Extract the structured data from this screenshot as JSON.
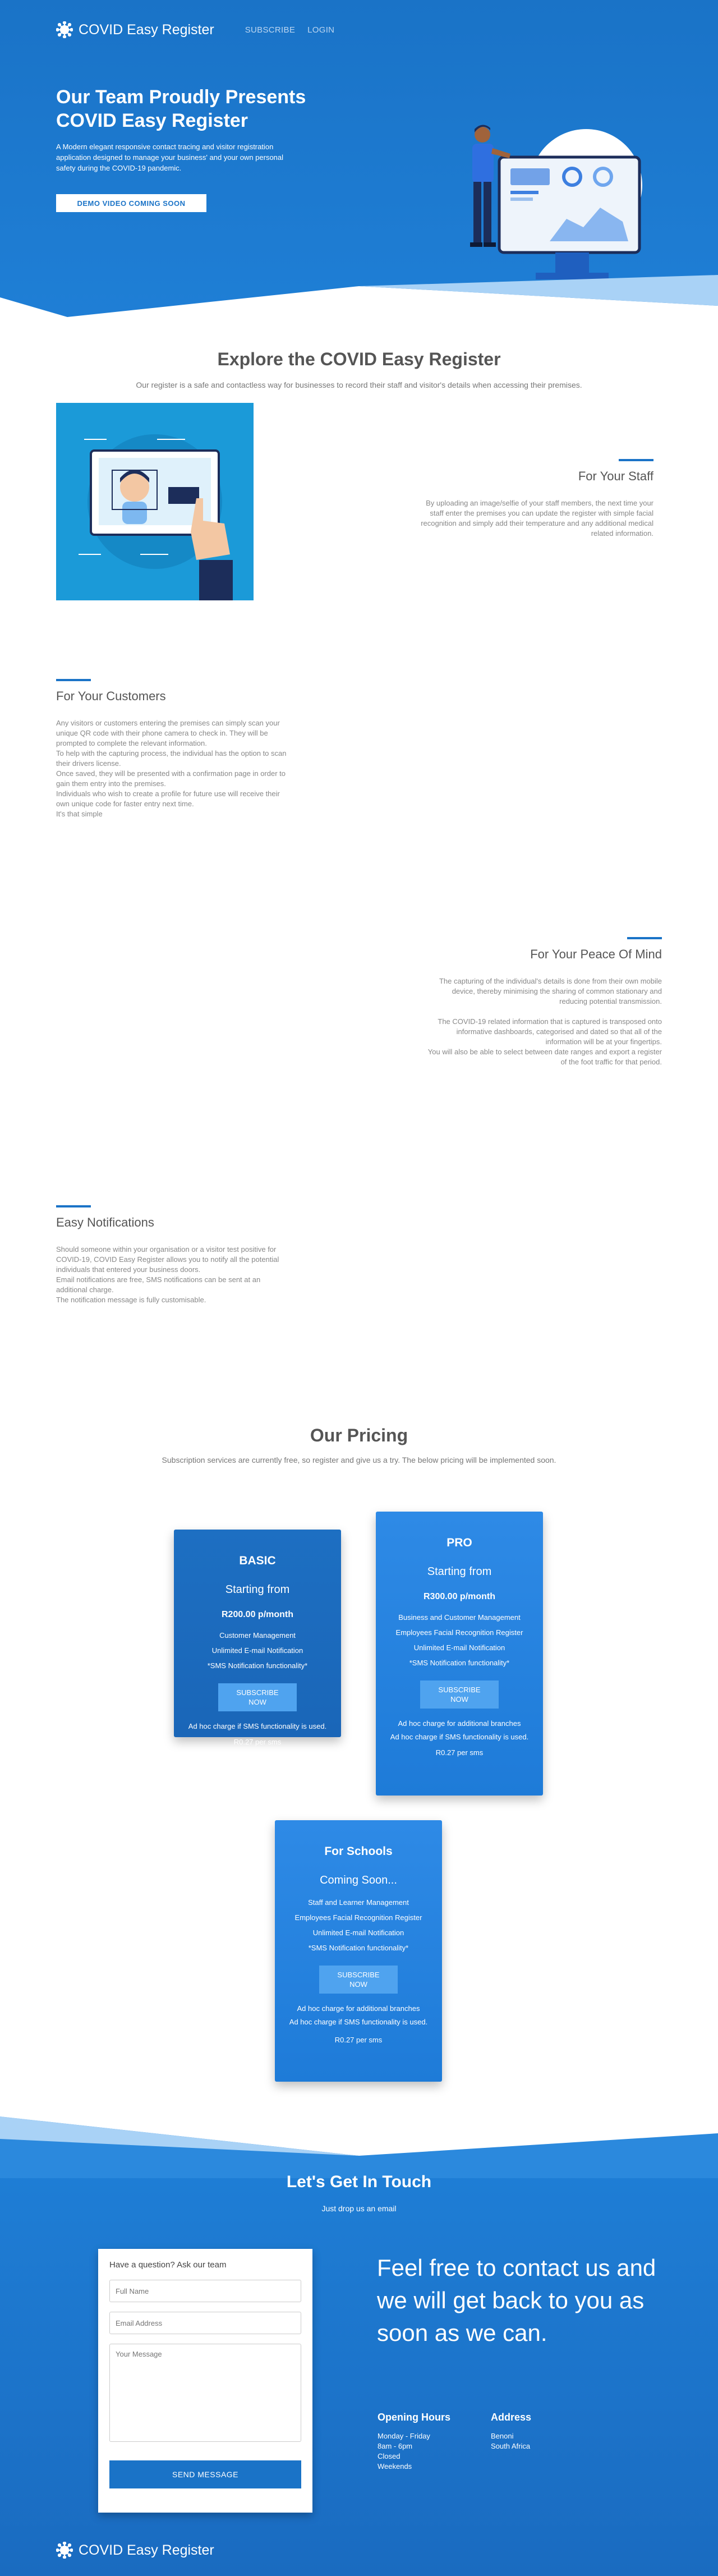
{
  "nav": {
    "brand": "COVID Easy Register",
    "links": [
      "SUBSCRIBE",
      "LOGIN"
    ]
  },
  "hero": {
    "title": "Our Team Proudly Presents COVID Easy Register",
    "description": "A Modern elegant responsive contact tracing and visitor registration application designed to manage your business' and your own personal safety during the COVID-19 pandemic.",
    "button": "DEMO VIDEO COMING SOON"
  },
  "explore": {
    "title": "Explore the COVID Easy Register",
    "subtitle": "Our register is a safe and contactless way for businesses to record their staff and visitor's details when accessing their premises."
  },
  "features": [
    {
      "title": "For Your Staff",
      "paragraphs": [
        "By uploading an image/selfie of your staff members, the next time your staff enter the premises you can update the register with simple facial recognition and simply add their temperature and any additional medical related information."
      ]
    },
    {
      "title": "For Your Customers",
      "paragraphs": [
        "Any visitors or customers entering the premises can simply scan your unique QR code with their phone camera to check in. They will be prompted to complete the relevant information.\nTo help with the capturing process, the individual has the option to scan their drivers license.\nOnce saved, they will be presented with a confirmation page in order to gain them entry into the premises.\nIndividuals who wish to create a profile for future use will receive their own unique code for faster entry next time.\nIt's that simple"
      ]
    },
    {
      "title": "For Your Peace Of Mind",
      "paragraphs": [
        "The capturing of the individual's details is done from their own mobile device, thereby minimising the sharing of common stationary and reducing potential transmission.",
        "The COVID-19 related information that is captured is transposed onto informative dashboards, categorised and dated so that all of the information will be at your fingertips.\nYou will also be able to select between date ranges and export a register of the foot traffic for that period."
      ]
    },
    {
      "title": "Easy Notifications",
      "paragraphs": [
        "Should someone within your organisation or a visitor test positive for COVID-19, COVID Easy Register allows you to notify all the potential individuals that entered your business doors.\nEmail notifications are free, SMS notifications can be sent at an additional charge.\nThe notification message is fully customisable."
      ]
    }
  ],
  "pricing": {
    "title": "Our Pricing",
    "subtitle": "Subscription services are currently free, so register and give us a try. The below pricing will be implemented soon.",
    "plans": [
      {
        "name": "BASIC",
        "starting": "Starting from",
        "price": "R200.00 p/month",
        "features": [
          "Customer Management",
          "Unlimited E-mail Notification",
          "*SMS Notification functionality*"
        ],
        "button": "SUBSCRIBE\nNOW",
        "notes": [
          "Ad hoc charge if SMS functionality is used.",
          "R0.27 per sms"
        ]
      },
      {
        "name": "PRO",
        "starting": "Starting from",
        "price": "R300.00 p/month",
        "features": [
          "Business and Customer Management",
          "Employees Facial Recognition Register",
          "Unlimited E-mail Notification",
          "*SMS Notification functionality*"
        ],
        "button": "SUBSCRIBE\nNOW",
        "notes": [
          "Ad hoc charge for additional branches",
          "Ad hoc charge if SMS functionality is used.",
          "R0.27 per sms"
        ]
      },
      {
        "name": "For Schools",
        "starting": "Coming Soon...",
        "price": "",
        "features": [
          "Staff and Learner Management",
          "Employees Facial Recognition Register",
          "Unlimited E-mail Notification",
          "*SMS Notification functionality*"
        ],
        "button": "SUBSCRIBE\nNOW",
        "notes": [
          "Ad hoc charge for additional branches",
          "Ad hoc charge if SMS functionality is used.",
          "R0.27 per sms"
        ]
      }
    ]
  },
  "contact": {
    "title": "Let's Get In Touch",
    "subtitle": "Just drop us an email",
    "form": {
      "question": "Have a question? Ask our team",
      "name_placeholder": "Full Name",
      "email_placeholder": "Email Address",
      "message_placeholder": "Your Message",
      "button": "SEND MESSAGE"
    },
    "tagline": "Feel free to contact us and we will get back to you as soon as we can.",
    "hours": {
      "title": "Opening Hours",
      "lines": [
        "Monday - Friday",
        "8am - 6pm",
        "Closed",
        "Weekends"
      ]
    },
    "address": {
      "title": "Address",
      "lines": [
        "Benoni",
        "South Africa"
      ]
    }
  },
  "footer": {
    "brand": "COVID Easy Register"
  },
  "colors": {
    "primary": "#1a73c7",
    "card": "#2686e3",
    "text": "#555555"
  }
}
